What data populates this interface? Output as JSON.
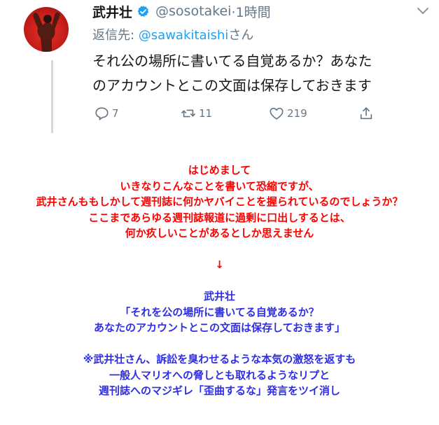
{
  "tweet": {
    "display_name": "武井壮",
    "handle": "@sosotakei",
    "time": "·1時間",
    "reply_to_prefix": "返信先: ",
    "reply_to_mention": "@sawakitaishi",
    "reply_to_suffix": "さん",
    "text_line1": "それ公の場所に書いてる自覚あるか？あなた",
    "text_line2": "のアカウントとこの文面は保存しておきます",
    "reply_count": "7",
    "retweet_count": "11",
    "like_count": "219",
    "colors": {
      "name": "#14171a",
      "secondary": "#657786",
      "mention": "#1da1f2",
      "verified": "#1da1f2"
    },
    "icons": [
      "verified-icon",
      "chevron-down-icon",
      "reply-icon",
      "retweet-icon",
      "like-icon",
      "share-icon"
    ]
  },
  "commentary": {
    "red_lines": [
      "はじめまして",
      "いきなりこんなことを書いて恐縮ですが、",
      "武井さんももしかして週刊誌に何かヤバイことを握られているのでしょうか？",
      "ここまであらゆる週刊誌報道に過剰に口出しするとは、",
      "何か疚しいことがあるとしか思えません"
    ],
    "arrow": "↓",
    "quote_name": "武井壮",
    "quote_line1": "「それを公の場所に書いてる自覚あるか？",
    "quote_line2": "あなたのアカウントとこの文面は保存しておきます」",
    "note_lines": [
      "※武井壮さん、訴訟を臭わせるような本気の激怒を返すも",
      "一般人マリオへの脅しとも取れるようなリプと",
      "週刊誌へのマジギレ「歪曲するな」発言をツイ消し"
    ],
    "colors": {
      "red": "#ff0000",
      "blue": "#2e2ee6"
    }
  }
}
